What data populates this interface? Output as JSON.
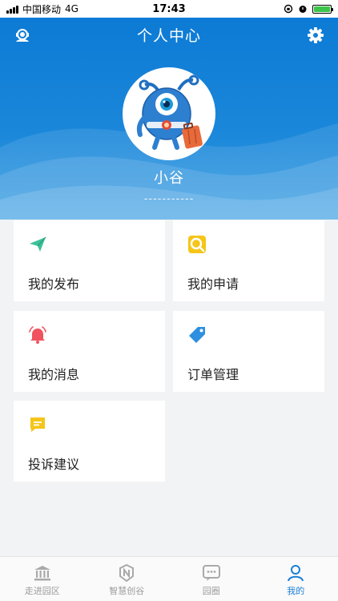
{
  "status_bar": {
    "carrier": "中国移动",
    "network": "4G",
    "time": "17:43"
  },
  "header": {
    "title": "个人中心",
    "left_icon": "headset-support-icon",
    "right_icon": "gear-icon",
    "username": "小谷",
    "subline": "-----------"
  },
  "menu": [
    {
      "label": "我的发布",
      "icon": "paper-plane-icon",
      "color": "#3cc19a"
    },
    {
      "label": "我的申请",
      "icon": "search-apply-icon",
      "color": "#f5c518"
    },
    {
      "label": "我的消息",
      "icon": "bell-icon",
      "color": "#f0525e"
    },
    {
      "label": "订单管理",
      "icon": "tag-icon",
      "color": "#2f8fe0"
    },
    {
      "label": "投诉建议",
      "icon": "chat-bubble-icon",
      "color": "#f5c518"
    }
  ],
  "tabbar": {
    "items": [
      {
        "label": "走进园区",
        "icon": "bank-icon",
        "active": false
      },
      {
        "label": "智慧创谷",
        "icon": "shield-logo-icon",
        "active": false
      },
      {
        "label": "园圈",
        "icon": "chat-dots-icon",
        "active": false
      },
      {
        "label": "我的",
        "icon": "person-icon",
        "active": true
      }
    ],
    "active_color": "#1a7fd6",
    "inactive_color": "#9b9b9b"
  }
}
